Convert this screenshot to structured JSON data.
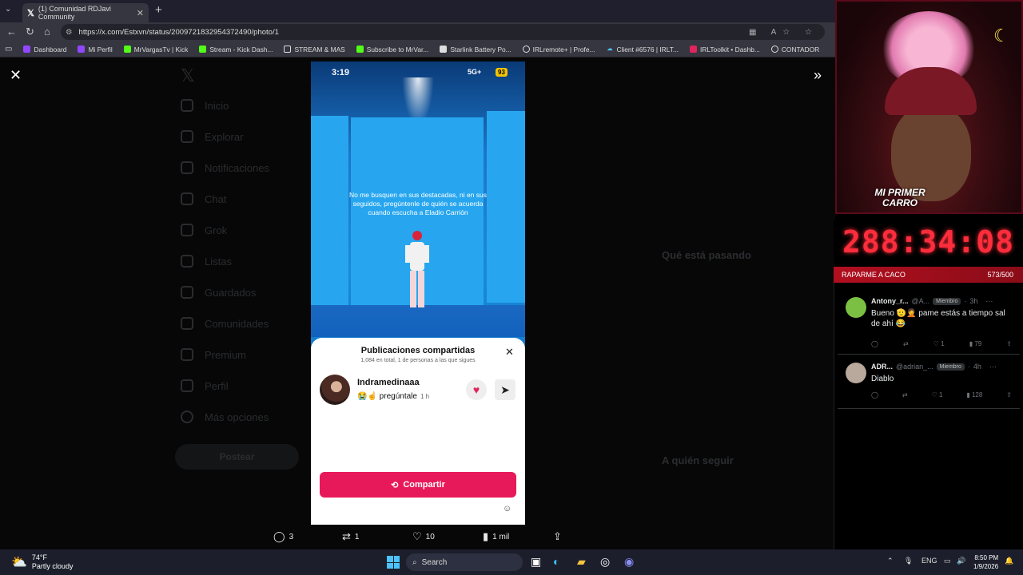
{
  "browser": {
    "tab_title": "(1) Comunidad RDJavi Community",
    "url": "https://x.com/Estxvn/status/2009721832954372490/photo/1",
    "bookmarks": [
      {
        "label": "Dashboard",
        "color": "#9147ff"
      },
      {
        "label": "Mi Perfil",
        "color": "#9147ff"
      },
      {
        "label": "MrVargasTv | Kick",
        "color": "#53fc18"
      },
      {
        "label": "Stream - Kick Dash...",
        "color": "#53fc18"
      },
      {
        "label": "STREAM & MAS",
        "color": "#dddddd"
      },
      {
        "label": "Subscribe to MrVar...",
        "color": "#53fc18"
      },
      {
        "label": "Starlink Battery Po...",
        "color": "#dddddd"
      },
      {
        "label": "IRLremote+ | Profe...",
        "color": "#dddddd"
      },
      {
        "label": "Client #6576 | IRLT...",
        "color": "#4cc2ff"
      },
      {
        "label": "IRLToolkit • Dashb...",
        "color": "#e0245e"
      },
      {
        "label": "CONTADOR",
        "color": "#dddddd"
      }
    ]
  },
  "x_page": {
    "nav": [
      "Inicio",
      "Explorar",
      "Notificaciones",
      "Chat",
      "Grok",
      "Listas",
      "Guardados",
      "Comunidades",
      "Premium",
      "Perfil",
      "Más opciones"
    ],
    "post_button": "Postear",
    "trending_header": "Qué está pasando",
    "follow_header": "A quién seguir"
  },
  "phone": {
    "time": "3:19",
    "network": "5G+",
    "battery": "93",
    "caption": "No me busquen en sus destacadas, ni en sus seguidos, pregúntenle de quién se acuerda cuando escucha a Eladio Carrión",
    "sheet": {
      "title": "Publicaciones compartidas",
      "subtitle": "1,084 en total, 1 de personas a las que sigues",
      "username": "Indramedinaaa",
      "reply": "😭☝️ pregúntale",
      "ago": "1 h",
      "share_button": "Compartir"
    }
  },
  "tweet_actions": {
    "replies": "3",
    "reposts": "1",
    "likes": "10",
    "views": "1 mil"
  },
  "overlay": {
    "sign_line1": "MI PRIMER",
    "sign_line2": "CARRO",
    "timer": "288:34:08",
    "goal_label": "RAPARME A CACO",
    "goal_progress": "573/500"
  },
  "chat": [
    {
      "name": "Antony_r...",
      "handle": "@A...",
      "badge": "Miembro",
      "time": "3h",
      "text": "Bueno 🫡🤦 pame estás a tiempo sal de ahí 😂",
      "likes": "1",
      "views": "79",
      "avatar_color": "#7cc043"
    },
    {
      "name": "ADR...",
      "handle": "@adrian_...",
      "badge": "Miembro",
      "time": "4h",
      "text": "Diablo",
      "likes": "1",
      "views": "128",
      "avatar_color": "#b9a89c"
    }
  ],
  "taskbar": {
    "temp": "74°F",
    "weather": "Partly cloudy",
    "search": "Search",
    "lang": "ENG",
    "time": "8:50 PM",
    "date": "1/9/2026"
  }
}
